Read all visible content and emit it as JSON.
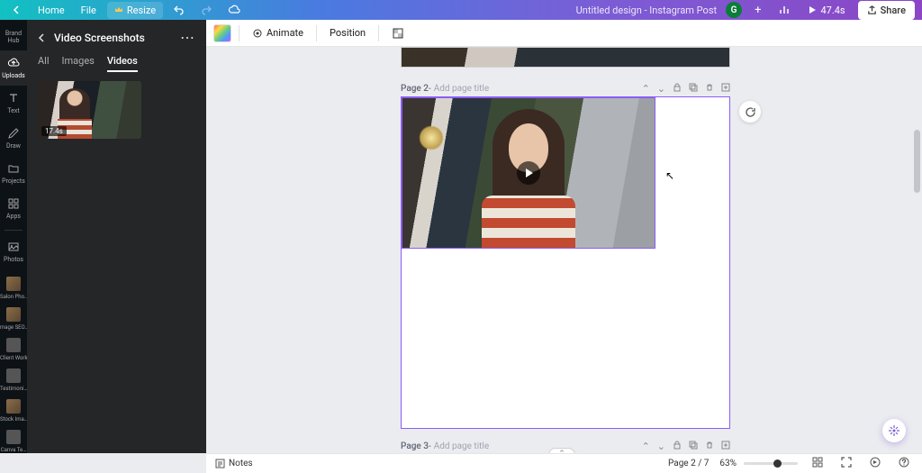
{
  "header": {
    "home": "Home",
    "file": "File",
    "resize": "Resize",
    "title": "Untitled design - Instagram Post",
    "avatar_initial": "G",
    "duration": "47.4s",
    "share": "Share"
  },
  "rail": {
    "brand": "Brand Hub",
    "uploads": "Uploads",
    "text": "Text",
    "draw": "Draw",
    "projects": "Projects",
    "apps": "Apps",
    "photos": "Photos",
    "folders": [
      "Salon Pho…",
      "mage SEO…",
      "Client Work",
      "Testimoni…",
      "Stock Ima…",
      "Canva Te…"
    ]
  },
  "panel": {
    "title": "Video Screenshots",
    "tabs": {
      "all": "All",
      "images": "Images",
      "videos": "Videos",
      "active": "Videos"
    },
    "thumb_duration": "17.4s"
  },
  "ctx": {
    "animate": "Animate",
    "position": "Position"
  },
  "pages": {
    "p2_label": "Page 2",
    "p3_label": "Page 3",
    "placeholder": "Add page title",
    "sep": " - "
  },
  "footer": {
    "notes": "Notes",
    "page_indicator": "Page 2 / 7",
    "zoom": "63%"
  }
}
